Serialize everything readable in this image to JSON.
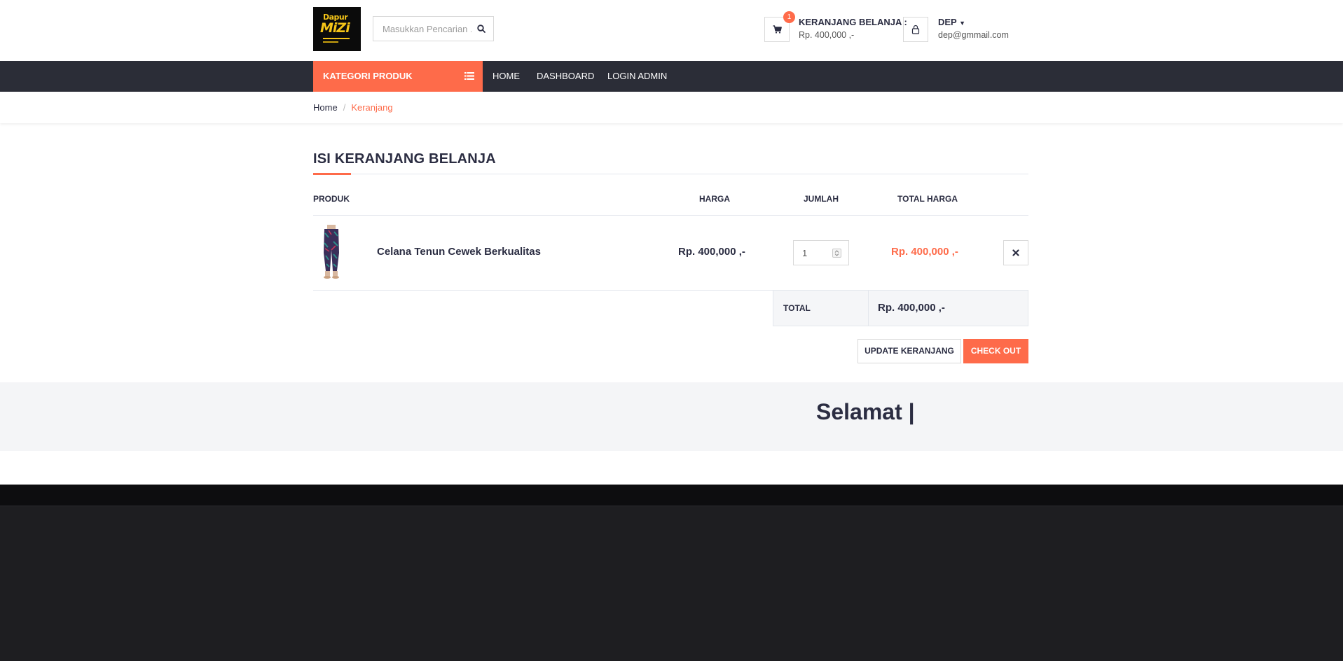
{
  "header": {
    "logo_text_top": "Dapur",
    "logo_text_main": "MiZi",
    "search_placeholder": "Masukkan Pencarian ...",
    "search_icon": "search-icon",
    "cart": {
      "badge_count": "1",
      "title": "KERANJANG BELANJA :",
      "amount": "Rp. 400,000 ,-",
      "icon": "cart-icon"
    },
    "user": {
      "name": "DEP",
      "email": "dep@gmmail.com",
      "icon": "user-icon"
    }
  },
  "nav": {
    "category_label": "KATEGORI PRODUK",
    "category_icon": "list-icon",
    "links": [
      "HOME",
      "DASHBOARD",
      "LOGIN ADMIN"
    ]
  },
  "breadcrumb": {
    "home": "Home",
    "separator": "/",
    "current": "Keranjang"
  },
  "cart_page": {
    "title": "ISI KERANJANG BELANJA",
    "columns": [
      "PRODUK",
      "HARGA",
      "JUMLAH",
      "TOTAL HARGA"
    ],
    "items": [
      {
        "name": "Celana Tenun Cewek Berkualitas",
        "price": "Rp. 400,000 ,-",
        "quantity": "1",
        "total": "Rp. 400,000 ,-"
      }
    ],
    "total_label": "TOTAL",
    "total_value": "Rp. 400,000 ,-",
    "update_button": "UPDATE KERANJANG",
    "checkout_button": "CHECK OUT"
  },
  "band": {
    "text": "Selamat |"
  },
  "colors": {
    "accent": "#fe6b4a",
    "nav_bg": "#2b2d37",
    "text_dark": "#2b2d42",
    "footer_bg": "#1e1e21"
  }
}
